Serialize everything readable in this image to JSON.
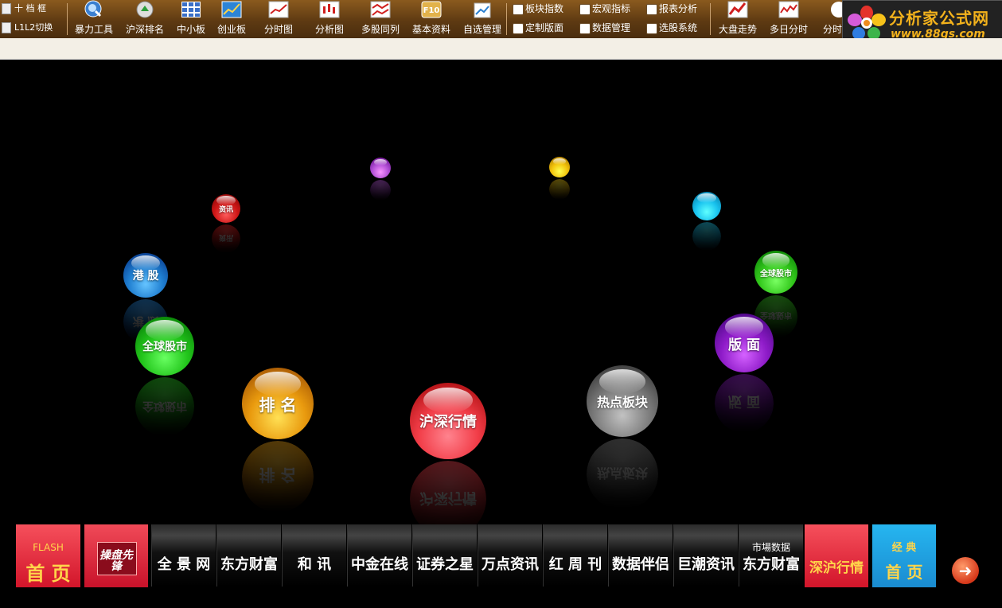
{
  "toolbar": {
    "left": [
      {
        "label": "十 档 框"
      },
      {
        "label": "L1L2切换"
      }
    ],
    "tools": [
      {
        "label": "暴力工具",
        "icon": "magnifier-icon",
        "color": "#3a7fd0"
      },
      {
        "label": "沪深排名",
        "icon": "compass-icon",
        "color": "#d8d8d8"
      },
      {
        "label": "中小板",
        "icon": "grid-icon",
        "color": "#3a6fc8"
      },
      {
        "label": "创业板",
        "icon": "chart-board-icon",
        "color": "#2c84d6"
      },
      {
        "label": "分时图",
        "icon": "line-chart-icon",
        "color": "#f0f0f0"
      },
      {
        "label": "分析图",
        "icon": "candlestick-icon",
        "color": "#f0f0f0"
      },
      {
        "label": "多股同列",
        "icon": "multi-chart-icon",
        "color": "#f0f0f0"
      },
      {
        "label": "基本资料",
        "icon": "f10-icon",
        "color": "#e2b24b"
      },
      {
        "label": "自选管理",
        "icon": "portfolio-icon",
        "color": "#f0f0f0"
      }
    ],
    "small": [
      {
        "label": "板块指数",
        "icon": "sector-index-icon"
      },
      {
        "label": "定制版面",
        "icon": "layout-icon"
      },
      {
        "label": "宏观指标",
        "icon": "macro-icon"
      },
      {
        "label": "数据管理",
        "icon": "data-icon"
      },
      {
        "label": "报表分析",
        "icon": "report-icon"
      },
      {
        "label": "选股系统",
        "icon": "screener-icon"
      }
    ],
    "right": [
      {
        "label": "大盘走势",
        "icon": "trend-icon"
      },
      {
        "label": "多日分时",
        "icon": "multi-day-icon"
      },
      {
        "label": "分时",
        "icon": "clock-icon"
      }
    ]
  },
  "logo": {
    "title": "分析家公式网",
    "url": "www.88gs.com"
  },
  "balls": [
    {
      "label": "",
      "color": "#b24fd6"
    },
    {
      "label": "",
      "color": "#f2c20a"
    },
    {
      "label": "资讯",
      "color": "#d01818"
    },
    {
      "label": "",
      "color": "#19c3ef"
    },
    {
      "label": "港 股",
      "color": "#1f7ed0"
    },
    {
      "label": "全球股市",
      "color": "#33c81c"
    },
    {
      "label": "全球股市",
      "color": "#22c51b"
    },
    {
      "label": "版 面",
      "color": "#8e1bc8"
    },
    {
      "label": "排 名",
      "color": "#e99a0e"
    },
    {
      "label": "沪深行情",
      "color": "#f23d48"
    },
    {
      "label": "热点板块",
      "color": "#7c7c7c"
    }
  ],
  "bottom": {
    "flash": {
      "top": "FLASH",
      "main": "首 页"
    },
    "caopan": {
      "label": "操盘先锋"
    },
    "nav": [
      {
        "label": "全 景 网"
      },
      {
        "label": "东方财富"
      },
      {
        "label": "和  讯"
      },
      {
        "label": "中金在线"
      },
      {
        "label": "证券之星"
      },
      {
        "label": "万点资讯"
      },
      {
        "label": "红 周 刊"
      },
      {
        "label": "数据伴侣"
      },
      {
        "label": "巨潮资讯"
      },
      {
        "label": "东方财富",
        "sub": "市場数据"
      }
    ],
    "shenhu": {
      "label": "深沪行情"
    },
    "classic": {
      "top": "经  典",
      "main": "首  页"
    }
  }
}
